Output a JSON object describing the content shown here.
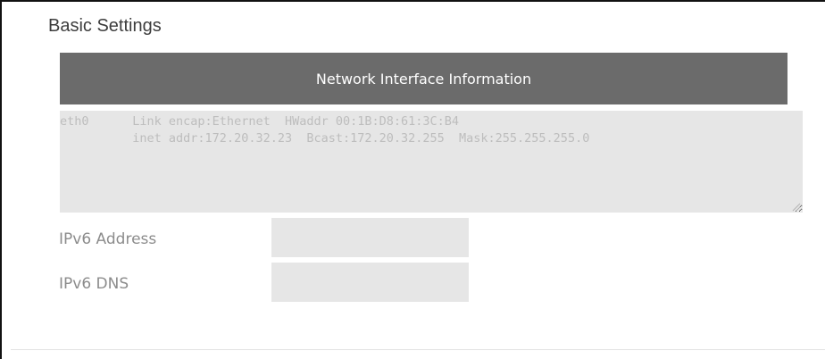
{
  "section": {
    "title": "Basic Settings"
  },
  "network_info": {
    "header": "Network Interface Information",
    "text": "eth0      Link encap:Ethernet  HWaddr 00:1B:D8:61:3C:B4\n          inet addr:172.20.32.23  Bcast:172.20.32.255  Mask:255.255.255.0"
  },
  "fields": [
    {
      "label": "IPv6 Address",
      "value": ""
    },
    {
      "label": "IPv6 DNS",
      "value": ""
    }
  ],
  "colors": {
    "header_bg": "#6b6b6b",
    "field_bg": "#e6e6e6",
    "label_text": "#8c8c8c"
  }
}
